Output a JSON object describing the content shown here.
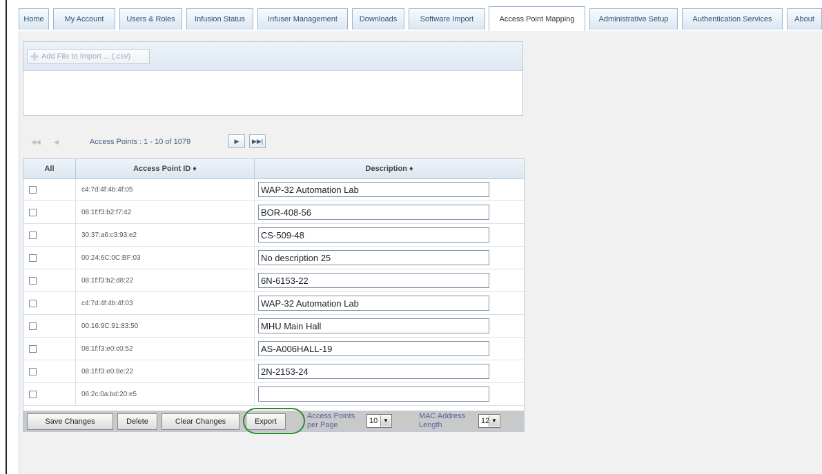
{
  "tabs": [
    {
      "label": "Home",
      "active": false
    },
    {
      "label": "My Account",
      "active": false
    },
    {
      "label": "Users & Roles",
      "active": false
    },
    {
      "label": "Infusion Status",
      "active": false
    },
    {
      "label": "Infuser Management",
      "active": false
    },
    {
      "label": "Downloads",
      "active": false
    },
    {
      "label": "Software Import",
      "active": false
    },
    {
      "label": "Access Point Mapping",
      "active": true
    },
    {
      "label": "Administrative Setup",
      "active": false
    },
    {
      "label": "Authentication Services",
      "active": false
    },
    {
      "label": "About",
      "active": false
    }
  ],
  "import": {
    "add_file_label": "Add File to Import ... (.csv)"
  },
  "pager": {
    "first": "◀◀",
    "prev": "◀",
    "status": "Access Points : 1 - 10 of 1079",
    "next": "▶",
    "last": "▶▶|"
  },
  "table": {
    "columns": {
      "all": "All",
      "id": "Access Point ID ♦",
      "description": "Description ♦"
    },
    "rows": [
      {
        "id": "c4:7d:4f:4b:4f:05",
        "description": "WAP-32 Automation Lab"
      },
      {
        "id": "08:1f:f3:b2:f7:42",
        "description": "BOR-408-56"
      },
      {
        "id": "30:37:a6:c3:93:e2",
        "description": "CS-509-48"
      },
      {
        "id": "00:24:6C:0C:BF:03",
        "description": "No description 25"
      },
      {
        "id": "08:1f:f3:b2:d8:22",
        "description": "6N-6153-22"
      },
      {
        "id": "c4:7d:4f:4b:4f:03",
        "description": "WAP-32 Automation Lab"
      },
      {
        "id": "00:16:9C:91:83:50",
        "description": "MHU Main Hall"
      },
      {
        "id": "08:1f:f3:e0:c0:52",
        "description": "AS-A006HALL-19"
      },
      {
        "id": "08:1f:f3:e0:8e:22",
        "description": "2N-2153-24"
      },
      {
        "id": "06:2c:0a:bd:20:e5",
        "description": ""
      }
    ]
  },
  "footer": {
    "save": "Save Changes",
    "delete": "Delete",
    "clear": "Clear Changes",
    "export": "Export",
    "per_page_label_1": "Access Points",
    "per_page_label_2": "per Page",
    "per_page_value": "10",
    "mac_label_1": "MAC Address",
    "mac_label_2": "Length",
    "mac_value": "12"
  },
  "colors": {
    "highlight_ring": "#2e8a2e",
    "tab_text": "#34506e"
  }
}
